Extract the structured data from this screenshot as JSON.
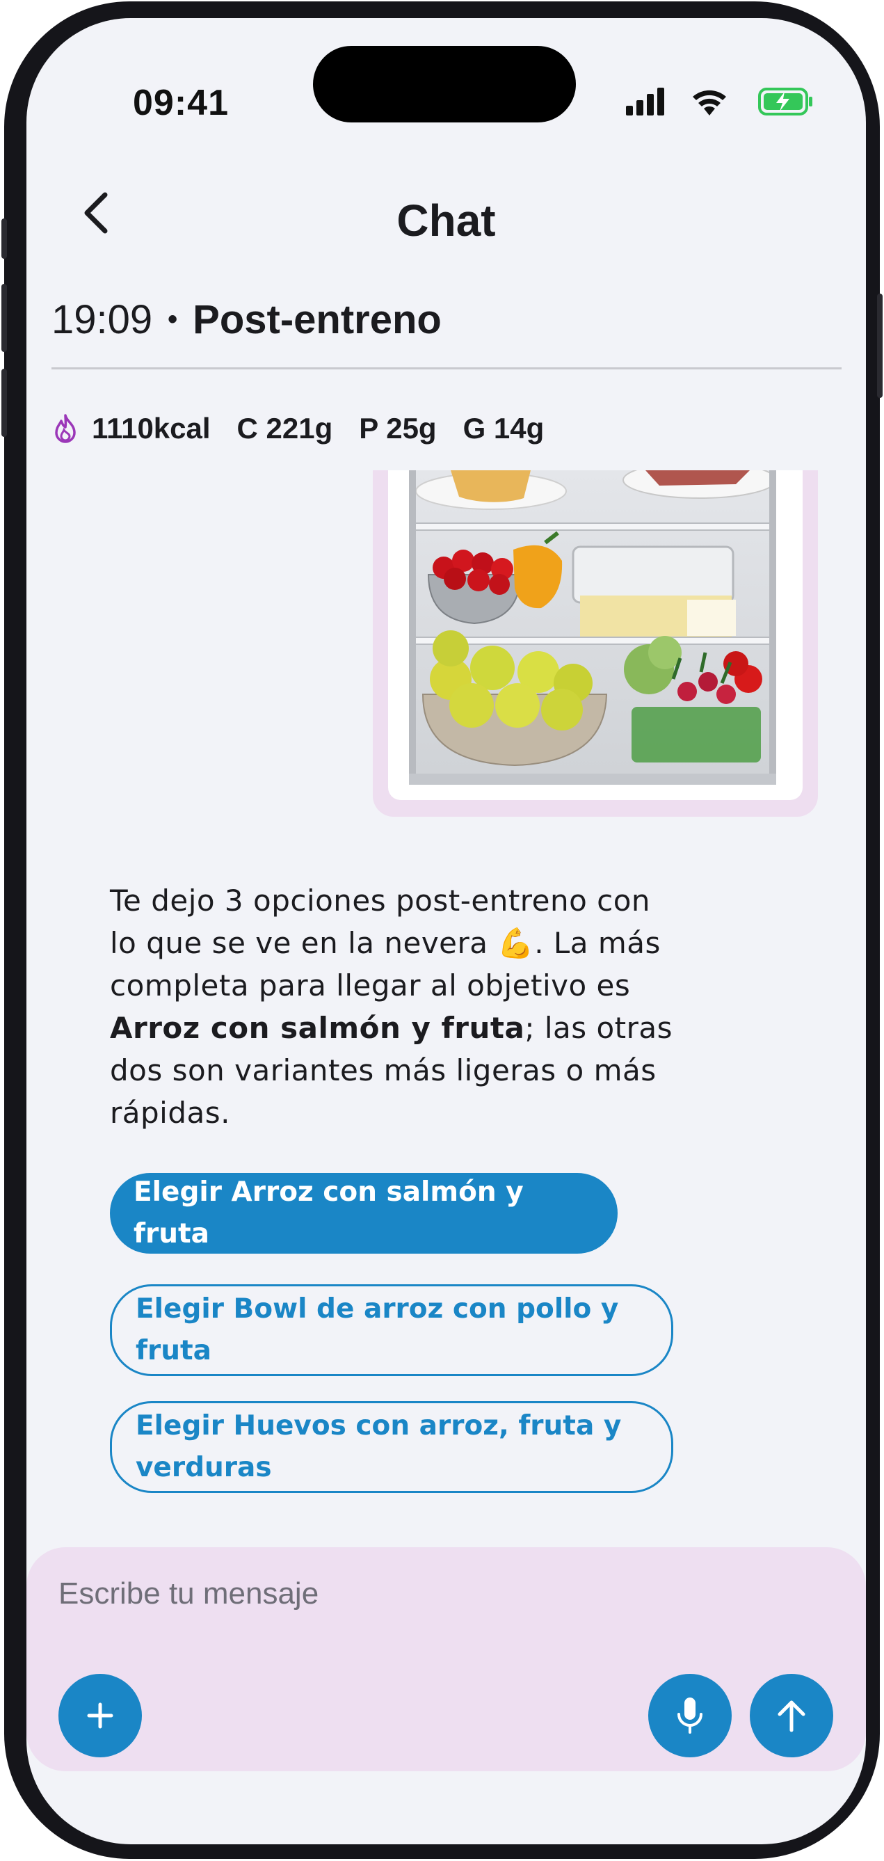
{
  "status_bar": {
    "time": "09:41"
  },
  "nav": {
    "title": "Chat",
    "back_icon": "chevron-left-icon"
  },
  "meal": {
    "time": "19:09",
    "separator": "•",
    "name": "Post-entreno",
    "macros": {
      "kcal": "1110kcal",
      "carbs": "C 221g",
      "protein": "P 25g",
      "fat": "G 14g",
      "icon": "flame-icon"
    }
  },
  "message": {
    "line_1": "Te dejo 3 opciones post-entreno con lo que se ve en la nevera",
    "emoji": "💪",
    "line_2": ". La más completa para llegar al objetivo es",
    "highlight": "Arroz con salmón y fruta",
    "line_3": "; las otras dos son variantes más ligeras o más rápidas."
  },
  "options": {
    "primary": "Elegir Arroz con salmón y fruta",
    "second": "Elegir Bowl de arroz con pollo y fruta",
    "third": "Elegir Huevos con arroz, fruta y verduras"
  },
  "composer": {
    "placeholder": "Escribe tu mensaje",
    "value": ""
  },
  "colors": {
    "accent": "#1a86c6",
    "composer_bg": "#eedff1",
    "screen_bg": "#f2f3f8",
    "macro_icon": "#9b37b8",
    "battery": "#34c759"
  }
}
